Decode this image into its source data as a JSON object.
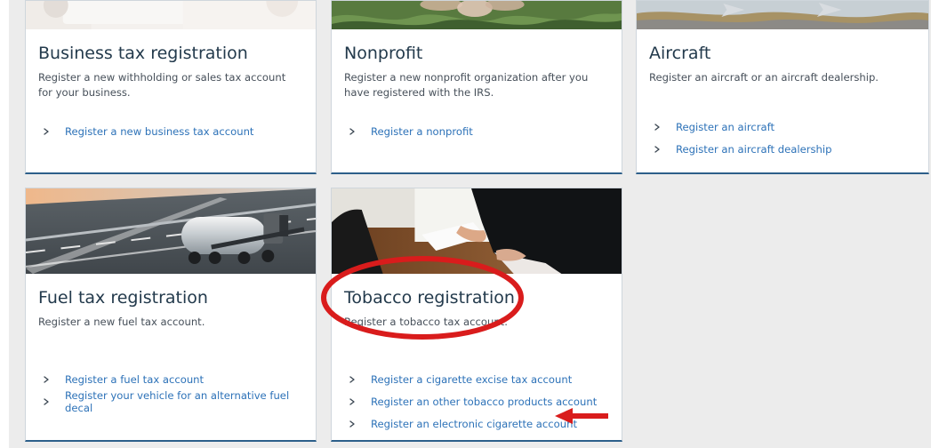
{
  "cards": [
    {
      "title": "Business tax registration",
      "description": "Register a new withholding or sales tax account for your business.",
      "links": [
        "Register a new business tax account"
      ]
    },
    {
      "title": "Nonprofit",
      "description": "Register a new nonprofit organization after you have registered with the IRS.",
      "links": [
        "Register a nonprofit"
      ]
    },
    {
      "title": "Aircraft",
      "description": "Register an aircraft or an aircraft dealership.",
      "links": [
        "Register an aircraft",
        "Register an aircraft dealership"
      ]
    },
    {
      "title": "Fuel tax registration",
      "description": "Register a new fuel tax account.",
      "links": [
        "Register a fuel tax account",
        "Register your vehicle for an alternative fuel decal"
      ]
    },
    {
      "title": "Tobacco registration",
      "description": "Register a tobacco tax account.",
      "links": [
        "Register a cigarette excise tax account",
        "Register an other tobacco products account",
        "Register an electronic cigarette account"
      ]
    }
  ],
  "colors": {
    "page_background": "#ececec",
    "card_border": "#cfd6dc",
    "card_accent": "#2d5f8a",
    "title_text": "#233a4c",
    "body_text": "#47505a",
    "link_text": "#2d72b8",
    "annotation_red": "#d91c1c"
  },
  "icons": {
    "link_chevron": "chevron-right-icon",
    "annotation_arrow": "arrow-left-icon",
    "annotation_highlight": "ellipse-highlight"
  }
}
